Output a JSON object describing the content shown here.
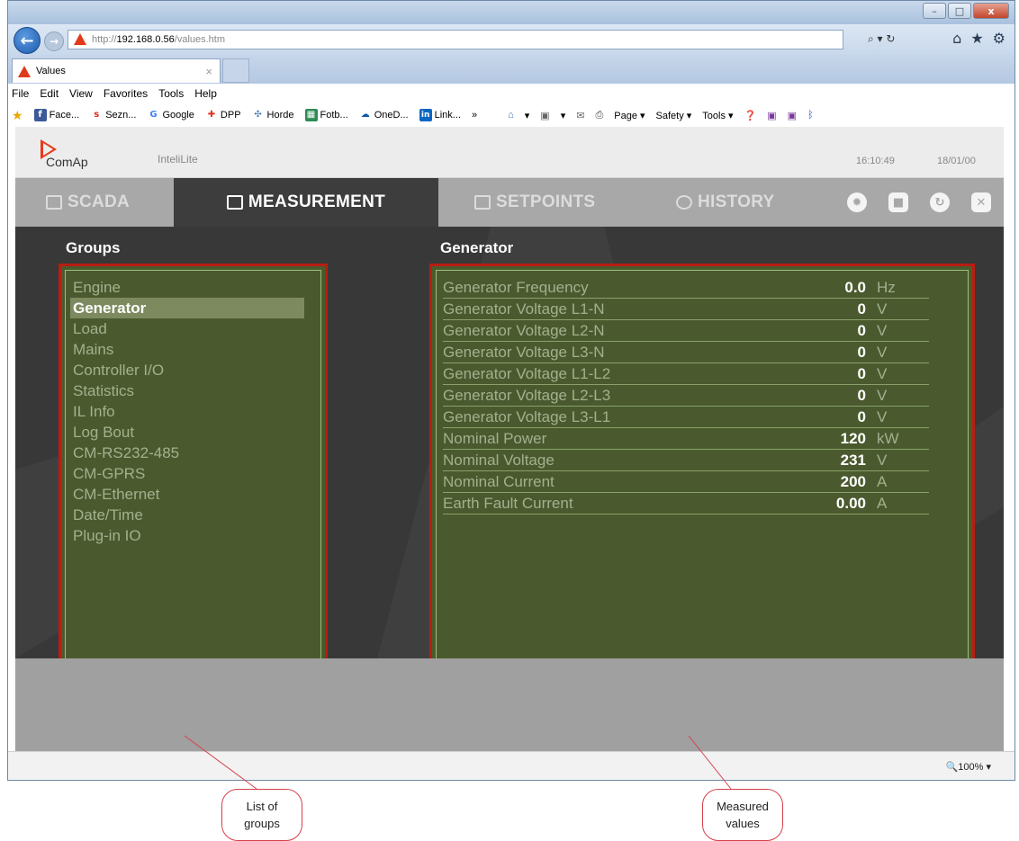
{
  "browser": {
    "window_controls": {
      "minimize": "–",
      "maximize": "□",
      "close": "x"
    },
    "address": {
      "prefix": "http://",
      "host": "192.168.0.56",
      "path": "/values.htm"
    },
    "address_tools": "⌕ ▾ ↻",
    "tab": {
      "title": "Values",
      "close": "×"
    },
    "menu": [
      "File",
      "Edit",
      "View",
      "Favorites",
      "Tools",
      "Help"
    ],
    "favorites": [
      {
        "icon_name": "facebook-icon",
        "glyph": "f",
        "color": "#3b5998",
        "label": "Face..."
      },
      {
        "icon_name": "seznam-icon",
        "glyph": "s",
        "color": "#d52b1e",
        "label": "Sezn..."
      },
      {
        "icon_name": "google-icon",
        "glyph": "G",
        "color": "#4285f4",
        "label": "Google"
      },
      {
        "icon_name": "dpp-icon",
        "glyph": "✚",
        "color": "#e0301e",
        "label": "DPP"
      },
      {
        "icon_name": "horde-icon",
        "glyph": "✣",
        "color": "#3a6fb0",
        "label": "Horde"
      },
      {
        "icon_name": "fotb-icon",
        "glyph": "▦",
        "color": "#2e8b57",
        "label": "Fotb..."
      },
      {
        "icon_name": "onedrive-icon",
        "glyph": "☁",
        "color": "#0f5aa8",
        "label": "OneD..."
      },
      {
        "icon_name": "linkedin-icon",
        "glyph": "in",
        "color": "#0a66c2",
        "label": "Link..."
      }
    ],
    "more_chevron": "»",
    "command_bar": [
      "▾",
      "▾",
      "Page ▾",
      "Safety ▾",
      "Tools ▾"
    ],
    "zoom": "🔍100%"
  },
  "app": {
    "brand": "ComAp",
    "product": "InteliLite",
    "time": "16:10:49",
    "date": "18/01/00",
    "nav": {
      "scada": "SCADA",
      "measurement": "MEASUREMENT",
      "setpoints": "SETPOINTS",
      "history": "HISTORY"
    },
    "groups_title": "Groups",
    "groups": [
      "Engine",
      "Generator",
      "Load",
      "Mains",
      "Controller I/O",
      "Statistics",
      "IL Info",
      "Log Bout",
      "CM-RS232-485",
      "CM-GPRS",
      "CM-Ethernet",
      "Date/Time",
      "Plug-in IO"
    ],
    "selected_group": "Generator",
    "values_title": "Generator",
    "values": [
      {
        "label": "Generator Frequency",
        "value": "0.0",
        "unit": "Hz"
      },
      {
        "label": "Generator Voltage L1-N",
        "value": "0",
        "unit": "V"
      },
      {
        "label": "Generator Voltage L2-N",
        "value": "0",
        "unit": "V"
      },
      {
        "label": "Generator Voltage L3-N",
        "value": "0",
        "unit": "V"
      },
      {
        "label": "Generator Voltage L1-L2",
        "value": "0",
        "unit": "V"
      },
      {
        "label": "Generator Voltage L2-L3",
        "value": "0",
        "unit": "V"
      },
      {
        "label": "Generator Voltage L3-L1",
        "value": "0",
        "unit": "V"
      },
      {
        "label": "Nominal Power",
        "value": "120",
        "unit": "kW"
      },
      {
        "label": "Nominal Voltage",
        "value": "231",
        "unit": "V"
      },
      {
        "label": "Nominal Current",
        "value": "200",
        "unit": "A"
      },
      {
        "label": "Earth Fault Current",
        "value": "0.00",
        "unit": "A"
      }
    ]
  },
  "annotations": {
    "groups_callout": [
      "List of",
      "groups"
    ],
    "values_callout": [
      "Measured",
      "values"
    ]
  },
  "colors": {
    "accent": "#b81d12",
    "panel": "#4a5a2e",
    "nav_bg": "#a8a8a8"
  }
}
